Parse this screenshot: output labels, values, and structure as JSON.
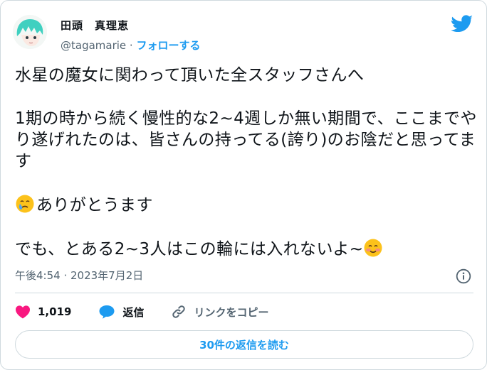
{
  "user": {
    "display_name": "田頭　真理恵",
    "handle": "@tagamarie",
    "separator": " · ",
    "follow_label": "フォローする"
  },
  "tweet": {
    "paragraphs": [
      "水星の魔女に関わって頂いた全スタッフさんへ",
      "1期の時から続く慢性的な2~4週しか無い期間で、ここまでやり遂げれたのは、皆さんの持ってる(誇り)のお陰だと思ってます",
      "ありがとうます",
      "でも、とある2~3人はこの輪には入れないよ~"
    ],
    "emoji_before_p3": "face-holding-back-tears-emoji",
    "emoji_after_p4": "smiling-face-emoji",
    "timestamp": "午後4:54 · 2023年7月2日"
  },
  "actions": {
    "like_count": "1,019",
    "reply_label": "返信",
    "copy_link_label": "リンクをコピー"
  },
  "read_replies_label": "30件の返信を読む",
  "colors": {
    "accent": "#1d9bf0",
    "heart": "#f91880",
    "text": "#0f1419",
    "secondary": "#536471",
    "border": "#cfd9de"
  },
  "icons": [
    "twitter-bird-icon",
    "info-icon",
    "heart-icon",
    "reply-bubble-icon",
    "link-icon"
  ]
}
